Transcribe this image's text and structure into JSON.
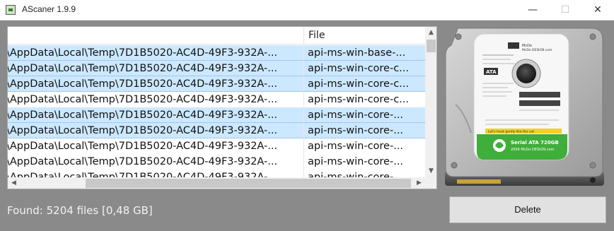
{
  "window": {
    "title": "AScaner 1.9.9",
    "minimize": "—",
    "maximize": "☐",
    "close": "✕"
  },
  "list": {
    "columns": [
      "",
      "File"
    ],
    "rows": [
      {
        "path": "\\AppData\\Local\\Temp\\7D1B5020-AC4D-49F3-932A-...",
        "file": "api-ms-win-base-...",
        "selected": true
      },
      {
        "path": "\\AppData\\Local\\Temp\\7D1B5020-AC4D-49F3-932A-...",
        "file": "api-ms-win-core-c...",
        "selected": true
      },
      {
        "path": "\\AppData\\Local\\Temp\\7D1B5020-AC4D-49F3-932A-...",
        "file": "api-ms-win-core-c...",
        "selected": true
      },
      {
        "path": "\\AppData\\Local\\Temp\\7D1B5020-AC4D-49F3-932A-...",
        "file": "api-ms-win-core-c...",
        "selected": false
      },
      {
        "path": "\\AppData\\Local\\Temp\\7D1B5020-AC4D-49F3-932A-...",
        "file": "api-ms-win-core-...",
        "selected": true
      },
      {
        "path": "\\AppData\\Local\\Temp\\7D1B5020-AC4D-49F3-932A-...",
        "file": "api-ms-win-core-...",
        "selected": true
      },
      {
        "path": "\\AppData\\Local\\Temp\\7D1B5020-AC4D-49F3-932A-...",
        "file": "api-ms-win-core-...",
        "selected": false
      },
      {
        "path": "\\AppData\\Local\\Temp\\7D1B5020-AC4D-49F3-932A-...",
        "file": "api-ms-win-core-...",
        "selected": false
      },
      {
        "path": "\\AppData\\Local\\Temp\\7D1B5020-AC4D-49F3-932A-...",
        "file": "api-ms-win-core-...",
        "selected": false
      }
    ]
  },
  "hdd_label": {
    "brand": "McDo DESIGN.com",
    "interface": "ATA",
    "banner": "Let's treat gently like the cat.",
    "model": "Serial ATA 720GB",
    "copyright": "2009 McDo DESIGN.com"
  },
  "status": {
    "text": "Found: 5204 files [0,48 GB]"
  },
  "actions": {
    "delete_label": "Delete"
  },
  "colors": {
    "window_bg": "#8a8a8a",
    "selected_row": "#cce8ff",
    "label_green": "#3fae3a"
  }
}
